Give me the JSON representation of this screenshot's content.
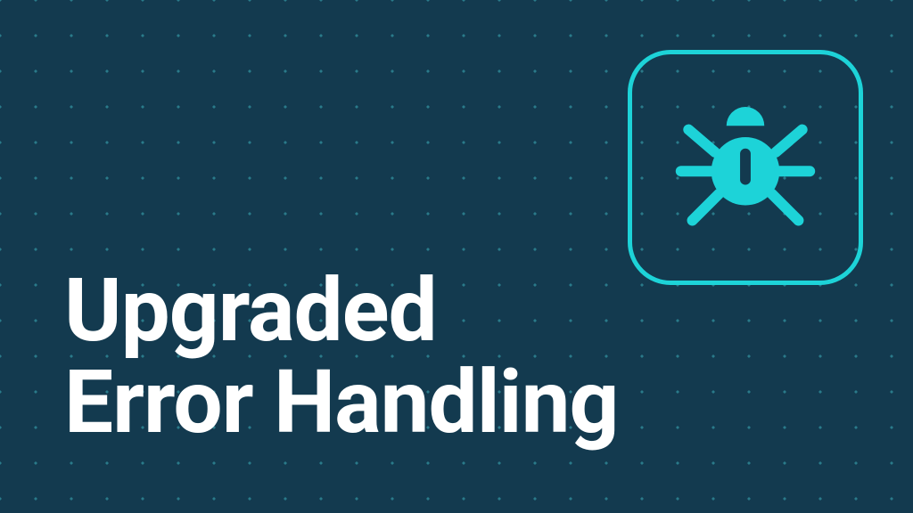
{
  "title": {
    "line1": "Upgraded",
    "line2": "Error Handling"
  },
  "icon": {
    "name": "bug-icon"
  },
  "colors": {
    "background": "#133a4f",
    "accent": "#1dd3d8",
    "text": "#ffffff"
  }
}
